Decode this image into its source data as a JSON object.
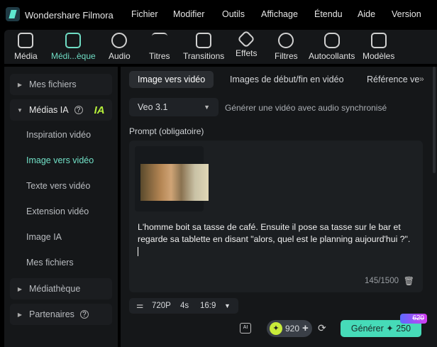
{
  "app": {
    "title": "Wondershare Filmora"
  },
  "menu": [
    "Fichier",
    "Modifier",
    "Outils",
    "Affichage",
    "Étendu",
    "Aide",
    "Version"
  ],
  "toolbar": [
    {
      "label": "Média",
      "icon": "media-icon"
    },
    {
      "label": "Médi...èque",
      "icon": "store-icon",
      "active": true
    },
    {
      "label": "Audio",
      "icon": "music-icon"
    },
    {
      "label": "Titres",
      "icon": "text-icon"
    },
    {
      "label": "Transitions",
      "icon": "transition-icon"
    },
    {
      "label": "Effets",
      "icon": "effects-icon"
    },
    {
      "label": "Filtres",
      "icon": "filters-icon"
    },
    {
      "label": "Autocollants",
      "icon": "sticker-icon"
    },
    {
      "label": "Modèles",
      "icon": "templates-icon"
    }
  ],
  "sidebar": {
    "mes_fichiers": "Mes fichiers",
    "medias_ia": "Médias IA",
    "ia_badge": "IA",
    "sub": [
      "Inspiration vidéo",
      "Image vers vidéo",
      "Texte vers vidéo",
      "Extension vidéo",
      "Image IA",
      "Mes fichiers"
    ],
    "mediatheque": "Médiathèque",
    "partenaires": "Partenaires",
    "accent": "#72e2c8"
  },
  "tabs": [
    "Image vers vidéo",
    "Images de début/fin en vidéo",
    "Référence ve"
  ],
  "model": {
    "value": "Veo 3.1",
    "audio_label": "Générer une vidéo avec audio synchronisé"
  },
  "prompt": {
    "label": "Prompt (obligatoire)",
    "text": "L'homme boit sa tasse de café. Ensuite il pose sa tasse sur le bar et regarde sa tablette en disant \"alors, quel est le planning aujourd'hui ?\".",
    "count": "145/1500"
  },
  "settings": {
    "resolution": "720P",
    "duration": "4s",
    "ratio": "16:9"
  },
  "credits": {
    "value": "920"
  },
  "generate": {
    "label": "Générer",
    "cost": "250",
    "old_cost": "620",
    "color": "#46dbb8"
  }
}
